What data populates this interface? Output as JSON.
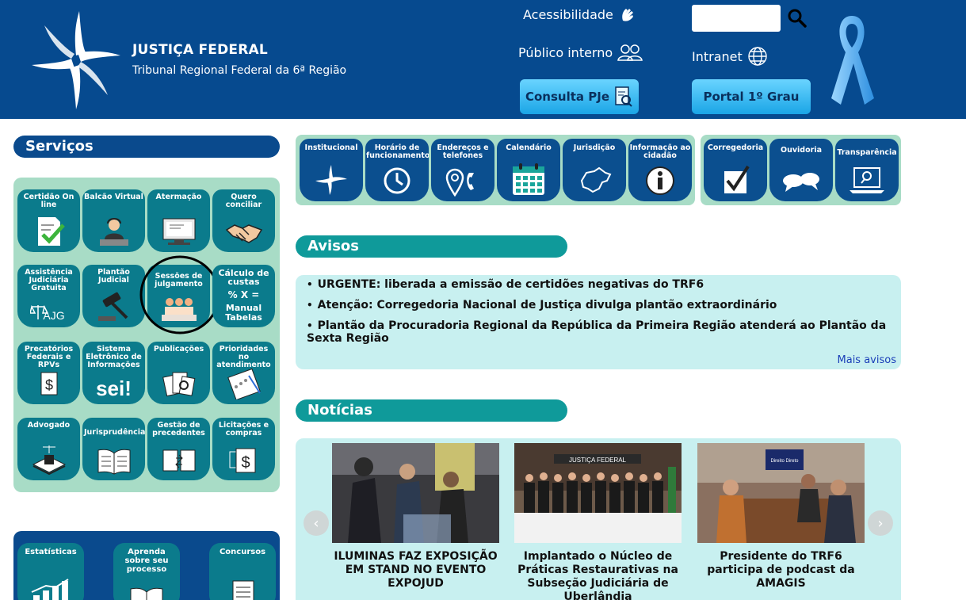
{
  "header": {
    "title": "JUSTIÇA FEDERAL",
    "subtitle": "Tribunal Regional Federal da 6ª Região",
    "accessibility": "Acessibilidade",
    "public": "Público interno",
    "intranet": "Intranet",
    "pje": "Consulta PJe",
    "portal": "Portal 1º Grau",
    "search_placeholder": ""
  },
  "services": {
    "title": "Serviços",
    "tiles": [
      {
        "label": "Certidão On line",
        "icon": "certificate-icon"
      },
      {
        "label": "Balcão Virtual",
        "icon": "attendant-icon"
      },
      {
        "label": "Atermação",
        "icon": "computer-icon"
      },
      {
        "label": "Quero conciliar",
        "icon": "handshake-icon"
      },
      {
        "label": "Assistência Judiciária Gratuita",
        "icon": "ajg-icon",
        "badge": "AJG"
      },
      {
        "label": "Plantão Judicial",
        "icon": "gavel-icon"
      },
      {
        "label": "Sessões de julgamento",
        "icon": "people-icon"
      },
      {
        "label": "Cálculo de custas",
        "icon": "calc-icon",
        "symbols": "% X =",
        "line1": "Manual",
        "line2": "Tabelas"
      },
      {
        "label": "Precatórios Federais e RPVs",
        "icon": "dollar-doc-icon"
      },
      {
        "label": "Sistema Eletrônico de Informações",
        "icon": "sei-icon",
        "badge": "sei!"
      },
      {
        "label": "Publicações",
        "icon": "publications-icon"
      },
      {
        "label": "Prioridades no atendimento",
        "icon": "priority-icon"
      },
      {
        "label": "Advogado",
        "icon": "lawyer-icon"
      },
      {
        "label": "Jurisprudência",
        "icon": "book-icon"
      },
      {
        "label": "Gestão de precedentes",
        "icon": "precedents-icon"
      },
      {
        "label": "Licitações e compras",
        "icon": "procurement-icon"
      }
    ],
    "bottom": [
      {
        "label": "Estatísticas",
        "icon": "stats-icon"
      },
      {
        "label": "Aprenda sobre seu processo",
        "icon": "learn-icon"
      },
      {
        "label": "Concursos",
        "icon": "exam-icon"
      }
    ]
  },
  "quick": [
    {
      "label": "Institucional",
      "icon": "institutional-icon"
    },
    {
      "label": "Horário de funcionamento",
      "icon": "clock-icon"
    },
    {
      "label": "Endereços e telefones",
      "icon": "address-icon"
    },
    {
      "label": "Calendário",
      "icon": "calendar-icon"
    },
    {
      "label": "Jurisdição",
      "icon": "map-icon"
    },
    {
      "label": "Informação ao cidadão",
      "icon": "info-icon"
    },
    {
      "label": "Corregedoria",
      "icon": "check-icon"
    },
    {
      "label": "Ouvidoria",
      "icon": "speech-icon"
    },
    {
      "label": "Transparência",
      "icon": "laptop-search-icon"
    }
  ],
  "avisos": {
    "title": "Avisos",
    "items": [
      "URGENTE: liberada a emissão de certidões negativas do TRF6",
      "Atenção: Corregedoria Nacional de Justiça divulga plantão extraordinário",
      "Plantão da Procuradoria Regional da República da Primeira Região atenderá ao Plantão da Sexta Região"
    ],
    "more": "Mais avisos"
  },
  "noticias": {
    "title": "Notícias",
    "items": [
      {
        "title": "ILUMINAS FAZ EXPOSIÇÃO EM STAND NO EVENTO EXPOJUD"
      },
      {
        "title": "Implantado o Núcleo de Práticas Restaurativas na Subseção Judiciária de Uberlândia",
        "sign": "JUSTIÇA FEDERAL"
      },
      {
        "title": "Presidente do TRF6 participa de podcast da AMAGIS",
        "tv": "Direito Direto"
      }
    ]
  }
}
